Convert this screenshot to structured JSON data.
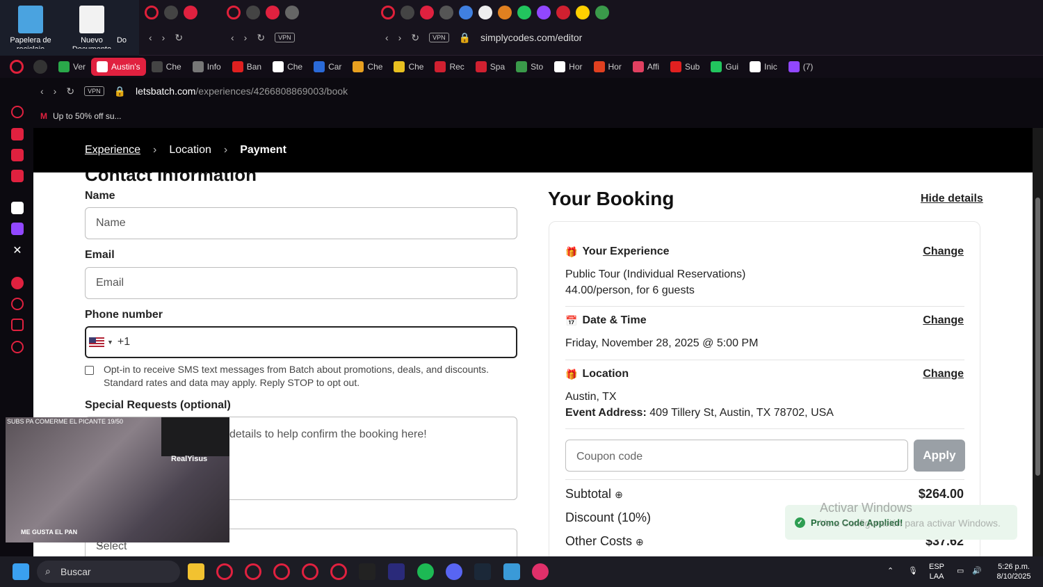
{
  "desktop": {
    "icons": [
      {
        "label": "Papelera de reciclaje"
      },
      {
        "label": "Nuevo Documento"
      },
      {
        "label": "Do"
      }
    ]
  },
  "bg_windows": {
    "win3_url": "simplycodes.com/editor",
    "vpn": "VPN"
  },
  "tabs": [
    {
      "label": "Ver",
      "color": "#2aa84a"
    },
    {
      "label": "Austin's",
      "color": "#e0213f",
      "active": true
    },
    {
      "label": "Che",
      "color": "#444"
    },
    {
      "label": "Info",
      "color": "#777"
    },
    {
      "label": "Ban",
      "color": "#e02020"
    },
    {
      "label": "Che",
      "color": "#fff"
    },
    {
      "label": "Car",
      "color": "#2a6ad8"
    },
    {
      "label": "Che",
      "color": "#e8a020"
    },
    {
      "label": "Che",
      "color": "#e8c020"
    },
    {
      "label": "Rec",
      "color": "#d02030"
    },
    {
      "label": "Spa",
      "color": "#d02030"
    },
    {
      "label": "Sto",
      "color": "#3a9a4a"
    },
    {
      "label": "Hor",
      "color": "#fff"
    },
    {
      "label": "Hor",
      "color": "#e04020"
    },
    {
      "label": "Affi",
      "color": "#e04060"
    },
    {
      "label": "Sub",
      "color": "#e02020"
    },
    {
      "label": "Gui",
      "color": "#22c55e"
    },
    {
      "label": "Inic",
      "color": "#fff"
    },
    {
      "label": "(7)",
      "color": "#9147ff"
    }
  ],
  "toolbar": {
    "vpn": "VPN",
    "url_host": "letsbatch.com",
    "url_path": "/experiences/4266808869003/book"
  },
  "bookmarks": {
    "item1": "Up to 50% off su..."
  },
  "breadcrumb": {
    "step1": "Experience",
    "sep": "›",
    "step2": "Location",
    "step3": "Payment"
  },
  "form": {
    "section_title": "Contact Information",
    "name_label": "Name",
    "name_placeholder": "Name",
    "email_label": "Email",
    "email_placeholder": "Email",
    "phone_label": "Phone number",
    "phone_code": "+1",
    "optin_text": "Opt-in to receive SMS text messages from Batch about promotions, deals, and discounts. Standard rates and data may apply. Reply STOP to opt out.",
    "special_label": "Special Requests (optional)",
    "special_placeholder": "details to help confirm the booking here!",
    "select_placeholder": "Select"
  },
  "booking": {
    "title": "Your Booking",
    "hide_details": "Hide details",
    "experience_title": "Your Experience",
    "change": "Change",
    "experience_name": "Public Tour (Individual Reservations)",
    "experience_price": "44.00/person, for 6 guests",
    "date_title": "Date & Time",
    "date_value": "Friday, November 28, 2025 @ 5:00 PM",
    "location_title": "Location",
    "location_city": "Austin, TX",
    "event_address_label": "Event Address:",
    "event_address": "409 Tillery St, Austin, TX 78702, USA",
    "coupon_placeholder": "Coupon code",
    "apply": "Apply",
    "subtotal_label": "Subtotal",
    "subtotal_value": "$264.00",
    "discount_label": "Discount (10%)",
    "other_label": "Other Costs",
    "other_value": "$37.62"
  },
  "toast": {
    "message": "Promo Code Applied!"
  },
  "watermark": {
    "line1": "Activar Windows",
    "line2": "Ve a Configuración para activar Windows."
  },
  "video": {
    "caption": "SUBS PA COMERME EL PICANTE 19/50",
    "streamer": "RealYisus",
    "bottom": "ME GUSTA EL PAN"
  },
  "taskbar": {
    "search": "Buscar",
    "lang1": "ESP",
    "lang2": "LAA",
    "time": "5:26 p.m.",
    "date": "8/10/2025"
  },
  "colors": {
    "opera_red": "#e0213f",
    "toast_green": "#2e9e52",
    "apply_gray": "#9aa0a6"
  }
}
